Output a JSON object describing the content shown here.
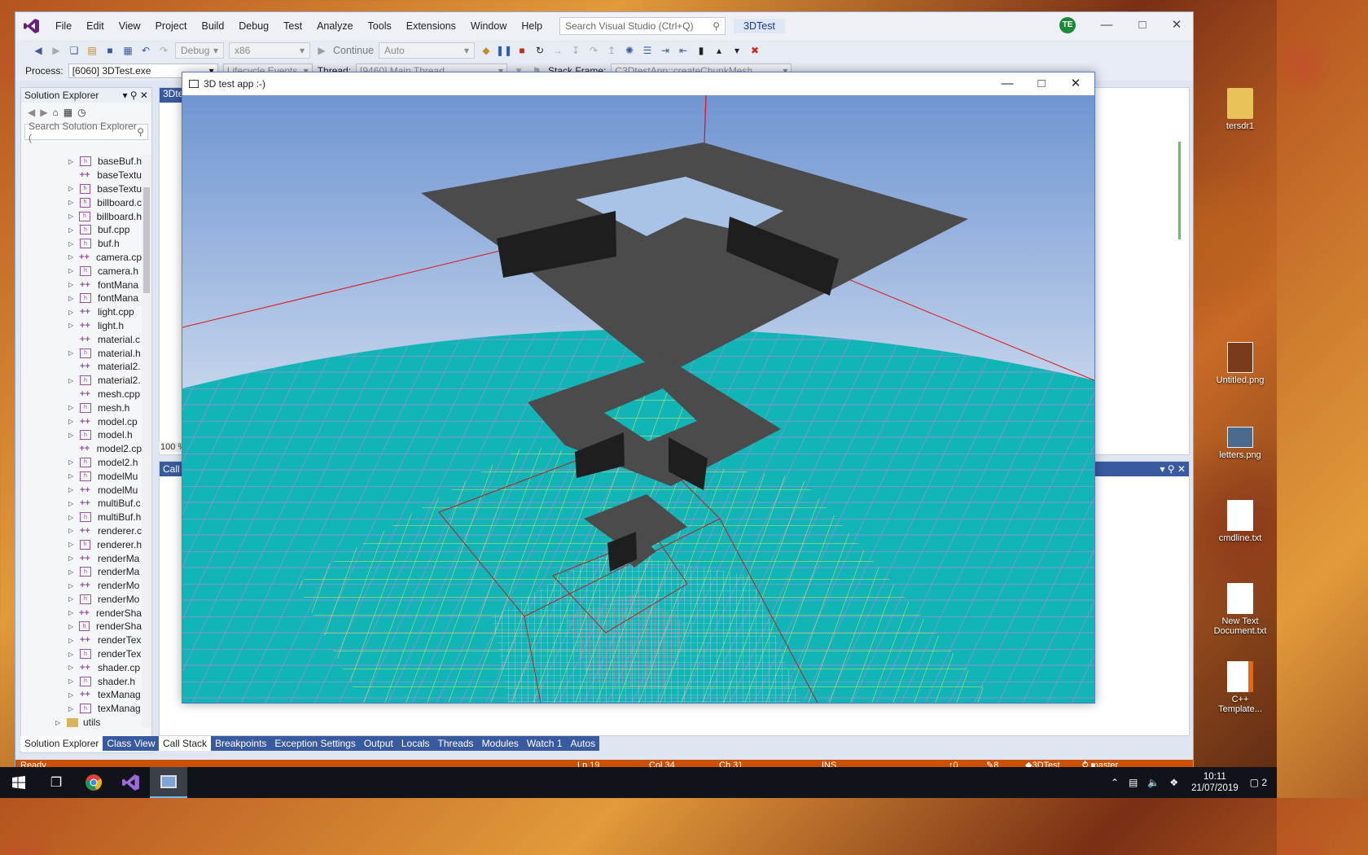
{
  "vs": {
    "menu": [
      "File",
      "Edit",
      "View",
      "Project",
      "Build",
      "Debug",
      "Test",
      "Analyze",
      "Tools",
      "Extensions",
      "Window",
      "Help"
    ],
    "search_placeholder": "Search Visual Studio (Ctrl+Q)",
    "project_name": "3DTest",
    "user_initials": "TE",
    "toolbar": {
      "config": "Debug",
      "platform": "x86",
      "continue": "Continue",
      "target": "Auto"
    },
    "toolbar2": {
      "process_label": "Process:",
      "process_value": "[6060] 3DTest.exe",
      "lifecycle": "Lifecycle Events",
      "thread_label": "Thread:",
      "thread_value": "[9460] Main Thread",
      "stack_label": "Stack Frame:",
      "stack_value": "C3DtestApp::createChunkMesh"
    },
    "solution_explorer": {
      "title": "Solution Explorer",
      "search_placeholder": "Search Solution Explorer (",
      "items": [
        {
          "kind": "file",
          "expand": true,
          "label": "baseBuf.h"
        },
        {
          "kind": "plus",
          "expand": false,
          "label": "baseTextu"
        },
        {
          "kind": "file",
          "expand": true,
          "label": "baseTextu"
        },
        {
          "kind": "file",
          "expand": true,
          "label": "billboard.c"
        },
        {
          "kind": "file",
          "expand": true,
          "label": "billboard.h"
        },
        {
          "kind": "file",
          "expand": true,
          "label": "buf.cpp"
        },
        {
          "kind": "file",
          "expand": true,
          "label": "buf.h"
        },
        {
          "kind": "plus",
          "expand": true,
          "label": "camera.cp"
        },
        {
          "kind": "file",
          "expand": true,
          "label": "camera.h"
        },
        {
          "kind": "plus",
          "expand": true,
          "label": "fontMana"
        },
        {
          "kind": "file",
          "expand": true,
          "label": "fontMana"
        },
        {
          "kind": "plus",
          "expand": true,
          "label": "light.cpp"
        },
        {
          "kind": "plus",
          "expand": true,
          "label": "light.h"
        },
        {
          "kind": "plus",
          "expand": false,
          "label": "material.c"
        },
        {
          "kind": "file",
          "expand": true,
          "label": "material.h"
        },
        {
          "kind": "plus",
          "expand": false,
          "label": "material2."
        },
        {
          "kind": "file",
          "expand": true,
          "label": "material2."
        },
        {
          "kind": "plus",
          "expand": false,
          "label": "mesh.cpp"
        },
        {
          "kind": "file",
          "expand": true,
          "label": "mesh.h"
        },
        {
          "kind": "plus",
          "expand": true,
          "label": "model.cp"
        },
        {
          "kind": "file",
          "expand": true,
          "label": "model.h"
        },
        {
          "kind": "plus",
          "expand": false,
          "label": "model2.cp"
        },
        {
          "kind": "file",
          "expand": true,
          "label": "model2.h"
        },
        {
          "kind": "file",
          "expand": true,
          "label": "modelMu"
        },
        {
          "kind": "plus",
          "expand": true,
          "label": "modelMu"
        },
        {
          "kind": "plus",
          "expand": true,
          "label": "multiBuf.c"
        },
        {
          "kind": "file",
          "expand": true,
          "label": "multiBuf.h"
        },
        {
          "kind": "plus",
          "expand": true,
          "label": "renderer.c"
        },
        {
          "kind": "file",
          "expand": true,
          "label": "renderer.h"
        },
        {
          "kind": "plus",
          "expand": true,
          "label": "renderMa"
        },
        {
          "kind": "file",
          "expand": true,
          "label": "renderMa"
        },
        {
          "kind": "plus",
          "expand": true,
          "label": "renderMo"
        },
        {
          "kind": "file",
          "expand": true,
          "label": "renderMo"
        },
        {
          "kind": "plus",
          "expand": true,
          "label": "renderSha"
        },
        {
          "kind": "file",
          "expand": true,
          "label": "renderSha"
        },
        {
          "kind": "plus",
          "expand": true,
          "label": "renderTex"
        },
        {
          "kind": "file",
          "expand": true,
          "label": "renderTex"
        },
        {
          "kind": "plus",
          "expand": true,
          "label": "shader.cp"
        },
        {
          "kind": "file",
          "expand": true,
          "label": "shader.h"
        },
        {
          "kind": "plus",
          "expand": true,
          "label": "texManag"
        },
        {
          "kind": "file",
          "expand": true,
          "label": "texManag"
        }
      ],
      "folder": "utils",
      "bottom_tabs": [
        "Solution Explorer",
        "Class View"
      ]
    },
    "editor_tab": "3Dtes",
    "zoom": "100 %",
    "callstack_title": "Call S",
    "debug_tabs": [
      "Call Stack",
      "Breakpoints",
      "Exception Settings",
      "Output",
      "Locals",
      "Threads",
      "Modules",
      "Watch 1",
      "Autos"
    ],
    "status": {
      "ready": "Ready",
      "ln": "Ln 19",
      "col": "Col 34",
      "ch": "Ch 31",
      "ins": "INS",
      "up": "0",
      "edits": "8",
      "repo": "3DTest",
      "branch": "master"
    }
  },
  "app": {
    "title": "3D test app :-)"
  },
  "desktop_icons": [
    {
      "label": "tersdr1"
    },
    {
      "label": "Untitled.png"
    },
    {
      "label": "letters.png"
    },
    {
      "label": "cmdline.txt"
    },
    {
      "label": "New Text Document.txt"
    },
    {
      "label": "C++ Template..."
    }
  ],
  "taskbar": {
    "time": "10:11",
    "date": "21/07/2019",
    "notifications": "2"
  },
  "colors": {
    "vs_blue": "#3a5aa0",
    "status_orange": "#ca5100",
    "sky_top": "#7fa3d6",
    "ground": "#12b5b5",
    "grid_pink": "#d67be8",
    "grid_yellow": "#e8e85a"
  }
}
